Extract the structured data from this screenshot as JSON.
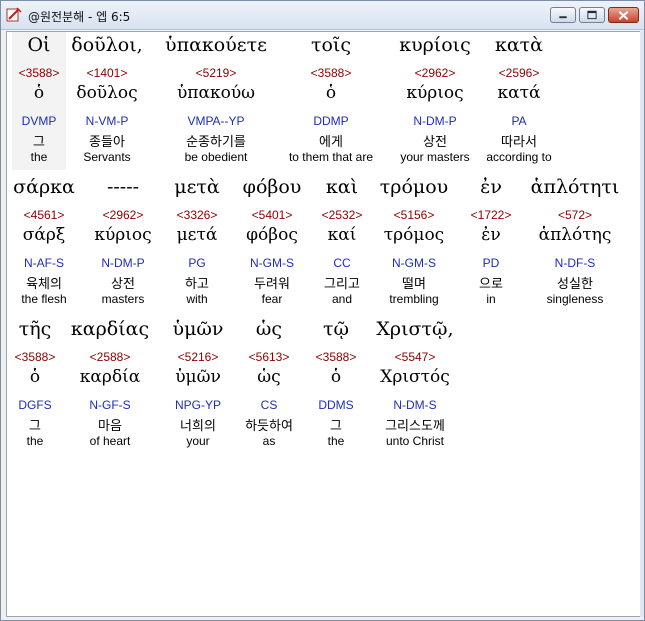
{
  "window": {
    "title": "@원전분해 - 엡 6:5",
    "app_icon": "bible-app-icon",
    "buttons": {
      "minimize": "minimize-icon",
      "maximize": "maximize-icon",
      "close": "close-icon"
    }
  },
  "words": [
    {
      "greek": "Οἱ",
      "strong": "<3588>",
      "lemma": "ὁ",
      "parse": "DVMP",
      "korean": "그",
      "english": "the"
    },
    {
      "greek": "δοῦλοι,",
      "strong": "<1401>",
      "lemma": "δοῦλος",
      "parse": "N-VM-P",
      "korean": "종들아",
      "english": "Servants"
    },
    {
      "greek": "ὑπακούετε",
      "strong": "<5219>",
      "lemma": "ὑπακούω",
      "parse": "VMPA--YP",
      "korean": "순종하기를",
      "english": "be obedient"
    },
    {
      "greek": "τοῖς",
      "strong": "<3588>",
      "lemma": "ὁ",
      "parse": "DDMP",
      "korean": "에게",
      "english": "to them that are"
    },
    {
      "greek": "κυρίοις",
      "strong": "<2962>",
      "lemma": "κύριος",
      "parse": "N-DM-P",
      "korean": "상전",
      "english": "your masters"
    },
    {
      "greek": "κατὰ",
      "strong": "<2596>",
      "lemma": "κατά",
      "parse": "PA",
      "korean": "따라서",
      "english": "according to"
    },
    {
      "greek": "σάρκα",
      "strong": "<4561>",
      "lemma": "σάρξ",
      "parse": "N-AF-S",
      "korean": "육체의",
      "english": "the flesh"
    },
    {
      "greek": "-----",
      "strong": "<2962>",
      "lemma": "κύριος",
      "parse": "N-DM-P",
      "korean": "상전",
      "english": "masters"
    },
    {
      "greek": "μετὰ",
      "strong": "<3326>",
      "lemma": "μετά",
      "parse": "PG",
      "korean": "하고",
      "english": "with"
    },
    {
      "greek": "φόβου",
      "strong": "<5401>",
      "lemma": "φόβος",
      "parse": "N-GM-S",
      "korean": "두려워",
      "english": "fear"
    },
    {
      "greek": "καὶ",
      "strong": "<2532>",
      "lemma": "καί",
      "parse": "CC",
      "korean": "그리고",
      "english": "and"
    },
    {
      "greek": "τρόμου",
      "strong": "<5156>",
      "lemma": "τρόμος",
      "parse": "N-GM-S",
      "korean": "떨며",
      "english": "trembling"
    },
    {
      "greek": "ἐν",
      "strong": "<1722>",
      "lemma": "ἐν",
      "parse": "PD",
      "korean": "으로",
      "english": "in"
    },
    {
      "greek": "ἁπλότητι",
      "strong": "<572>",
      "lemma": "ἁπλότης",
      "parse": "N-DF-S",
      "korean": "성실한",
      "english": "singleness"
    },
    {
      "greek": "τῆς",
      "strong": "<3588>",
      "lemma": "ὁ",
      "parse": "DGFS",
      "korean": "그",
      "english": "the"
    },
    {
      "greek": "καρδίας",
      "strong": "<2588>",
      "lemma": "καρδία",
      "parse": "N-GF-S",
      "korean": "마음",
      "english": "of heart"
    },
    {
      "greek": "ὑμῶν",
      "strong": "<5216>",
      "lemma": "ὑμῶν",
      "parse": "NPG-YP",
      "korean": "너희의",
      "english": "your"
    },
    {
      "greek": "ὡς",
      "strong": "<5613>",
      "lemma": "ὡς",
      "parse": "CS",
      "korean": "하듯하여",
      "english": "as"
    },
    {
      "greek": "τῷ",
      "strong": "<3588>",
      "lemma": "ὁ",
      "parse": "DDMS",
      "korean": "그",
      "english": "the"
    },
    {
      "greek": "Χριστῷ,",
      "strong": "<5547>",
      "lemma": "Χριστός",
      "parse": "N-DM-S",
      "korean": "그리스도께",
      "english": "unto Christ"
    }
  ]
}
